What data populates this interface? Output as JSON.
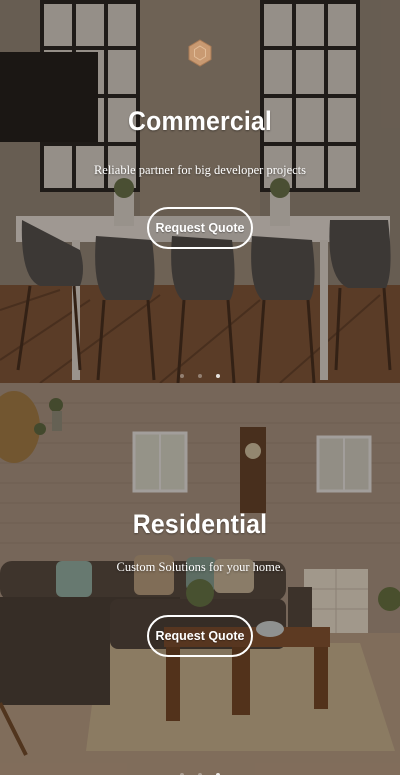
{
  "commercial": {
    "title": "Commercial",
    "subtitle": "Reliable partner for big developer projects",
    "cta_label": "Request Quote",
    "logo_icon": "hexagon-logo"
  },
  "residential": {
    "title": "Residential",
    "subtitle": "Custom Solutions for your home.",
    "cta_label": "Request Quote"
  },
  "slider": {
    "top_dots": 3,
    "top_active_index": 2,
    "bottom_dots": 3,
    "bottom_active_index": 2
  },
  "colors": {
    "overlay": "#281c14",
    "button_border": "#ffffff",
    "text": "#ffffff",
    "logo_fill": "#c99a72"
  }
}
